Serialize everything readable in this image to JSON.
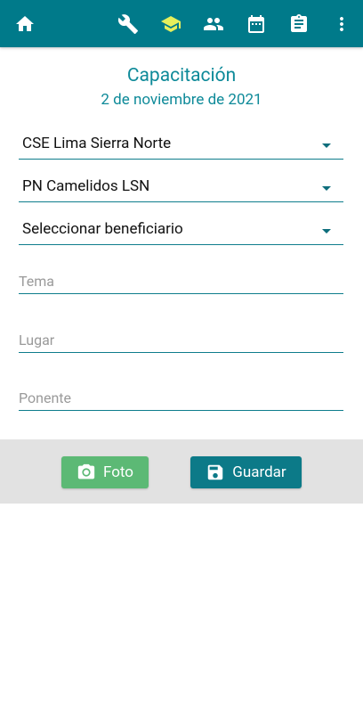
{
  "appbar": {
    "icons": [
      "home-icon",
      "wrench-icon",
      "graduation-cap-icon",
      "people-icon",
      "calendar-icon",
      "clipboard-icon",
      "more-vert-icon"
    ],
    "active_color": "#e6ef5c",
    "color": "#007a8a"
  },
  "header": {
    "title": "Capacitación",
    "date": "2 de noviembre de 2021"
  },
  "form": {
    "select1": "CSE Lima Sierra Norte",
    "select2": "PN Camelidos LSN",
    "select3": "Seleccionar beneficiario",
    "tema_placeholder": "Tema",
    "lugar_placeholder": "Lugar",
    "ponente_placeholder": "Ponente"
  },
  "actions": {
    "foto_label": "Foto",
    "save_label": "Guardar"
  }
}
